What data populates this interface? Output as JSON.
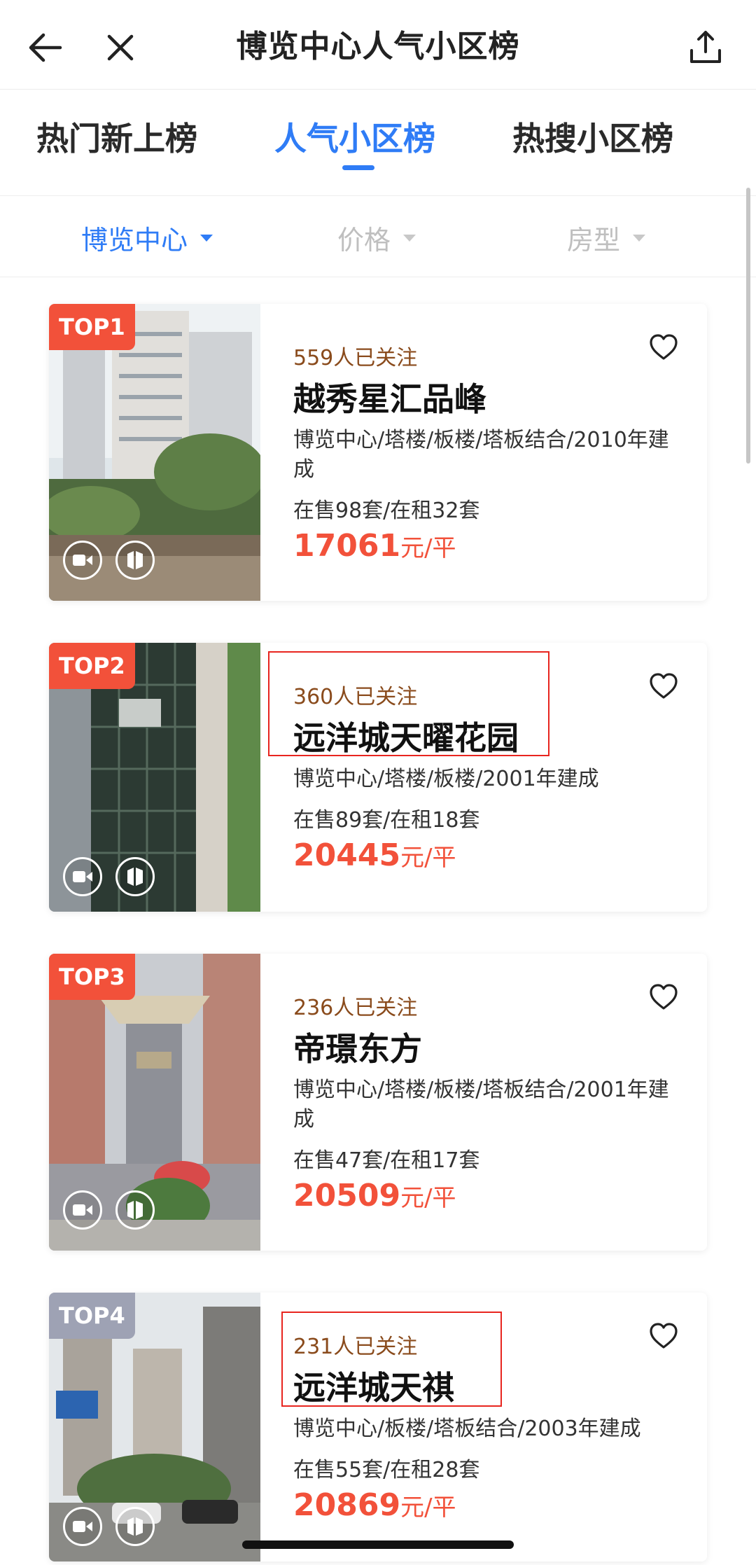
{
  "header": {
    "title": "博览中心人气小区榜",
    "back_icon": "arrow-left-icon",
    "close_icon": "close-icon",
    "share_icon": "share-icon"
  },
  "tabs": [
    {
      "label": "热门新上榜",
      "active": false
    },
    {
      "label": "人气小区榜",
      "active": true
    },
    {
      "label": "热搜小区榜",
      "active": false
    }
  ],
  "filters": [
    {
      "label": "博览中心",
      "active": true
    },
    {
      "label": "价格",
      "active": false
    },
    {
      "label": "房型",
      "active": false
    }
  ],
  "colors": {
    "accent": "#2f7cf6",
    "price": "#f2513a",
    "followers": "#8a4b1c",
    "rank_top": "#f2513a",
    "rank_other": "#9ea2b4"
  },
  "listings": [
    {
      "rank": "TOP1",
      "followers": "559人已关注",
      "name": "越秀星汇品峰",
      "desc": "博览中心/塔楼/板楼/塔板结合/2010年建成",
      "stock": "在售98套/在租32套",
      "price": "17061",
      "price_unit": "元/平"
    },
    {
      "rank": "TOP2",
      "followers": "360人已关注",
      "name": "远洋城天曜花园",
      "desc": "博览中心/塔楼/板楼/2001年建成",
      "stock": "在售89套/在租18套",
      "price": "20445",
      "price_unit": "元/平"
    },
    {
      "rank": "TOP3",
      "followers": "236人已关注",
      "name": "帝璟东方",
      "desc": "博览中心/塔楼/板楼/塔板结合/2001年建成",
      "stock": "在售47套/在租17套",
      "price": "20509",
      "price_unit": "元/平"
    },
    {
      "rank": "TOP4",
      "followers": "231人已关注",
      "name": "远洋城天祺",
      "desc": "博览中心/板楼/塔板结合/2003年建成",
      "stock": "在售55套/在租28套",
      "price": "20869",
      "price_unit": "元/平"
    }
  ]
}
